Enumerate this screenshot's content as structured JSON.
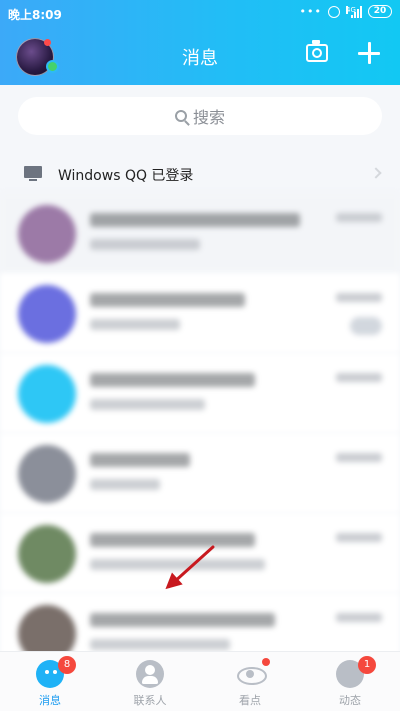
{
  "status_bar": {
    "time": "晚上8:09",
    "network": "4G",
    "battery": "20"
  },
  "header": {
    "title": "消息"
  },
  "search": {
    "placeholder": "搜索"
  },
  "device_notice": {
    "text": "Windows QQ 已登录"
  },
  "conversations": [
    {
      "avatar_color": "#9c7aa7",
      "title_w": 210,
      "sub_w": 110
    },
    {
      "avatar_color": "#6b6fe0",
      "title_w": 155,
      "sub_w": 90
    },
    {
      "avatar_color": "#2ec7f5",
      "title_w": 165,
      "sub_w": 115
    },
    {
      "avatar_color": "#8b8f9a",
      "title_w": 100,
      "sub_w": 70
    },
    {
      "avatar_color": "#6f8a63",
      "title_w": 165,
      "sub_w": 175
    },
    {
      "avatar_color": "#7a6f6a",
      "title_w": 185,
      "sub_w": 140
    }
  ],
  "tabbar": {
    "tabs": [
      {
        "label": "消息",
        "badge": "8",
        "icon": "message-icon"
      },
      {
        "label": "联系人",
        "icon": "contacts-icon"
      },
      {
        "label": "看点",
        "icon": "watch-icon"
      },
      {
        "label": "动态",
        "badge": "1",
        "icon": "feed-icon"
      }
    ]
  },
  "colors": {
    "accent": "#1fb2f6",
    "badge": "#f5483d",
    "arrow": "#c8191f"
  }
}
